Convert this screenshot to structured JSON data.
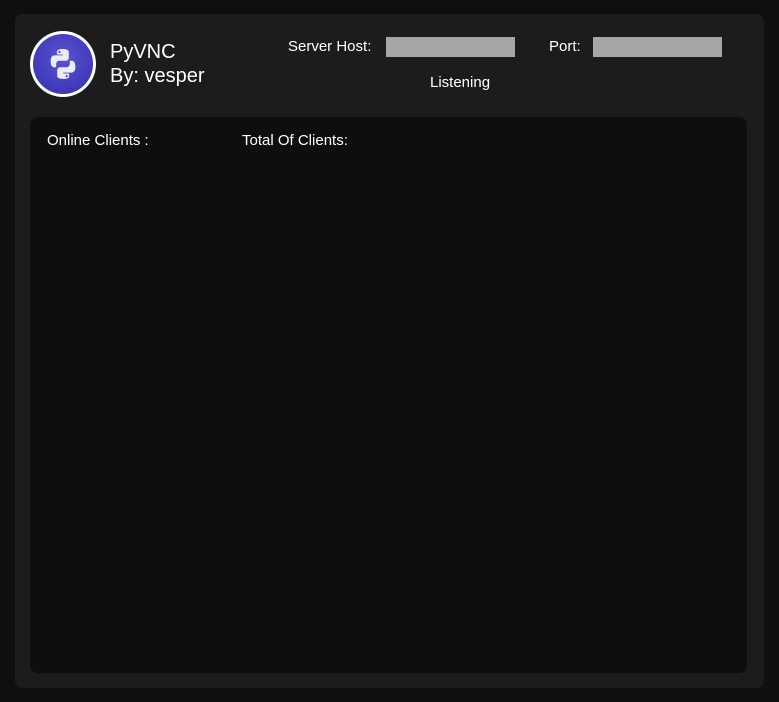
{
  "app": {
    "title": "PyVNC",
    "author": "By: vesper",
    "logo_icon": "python-logo-icon"
  },
  "server": {
    "host_label": "Server Host:",
    "host_value": "",
    "port_label": "Port:",
    "port_value": "",
    "status": "Listening"
  },
  "clients": {
    "online_label": "Online Clients :",
    "total_label": "Total Of Clients:"
  },
  "colors": {
    "background": "#0f0f0f",
    "window": "#1c1c1c",
    "panel": "#0e0e0e",
    "input": "#a6a6a6",
    "logo_accent": "#4a43c7"
  }
}
